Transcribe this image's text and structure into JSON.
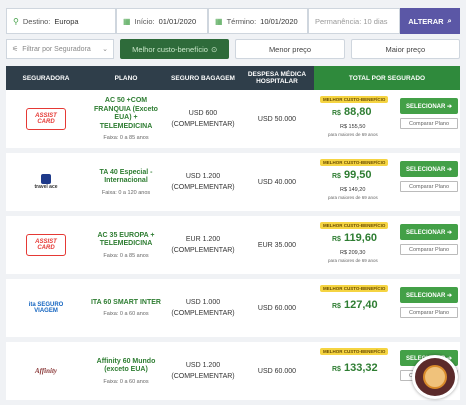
{
  "search": {
    "destino_label": "Destino:",
    "destino_value": "Europa",
    "inicio_label": "Início:",
    "inicio_value": "01/01/2020",
    "termino_label": "Término:",
    "termino_value": "10/01/2020",
    "permanencia": "Permanência: 10 dias",
    "alterar_label": "ALTERAR"
  },
  "filters": {
    "seguradora_placeholder": "Filtrar por Seguradora",
    "sort_options": [
      "Melhor custo-benefício",
      "Menor preço",
      "Maior preço"
    ],
    "active_sort": "Melhor custo-benefício"
  },
  "table": {
    "headers": [
      "SEGURADORA",
      "PLANO",
      "SEGURO BAGAGEM",
      "DESPESA MÉDICA HOSPITALAR",
      "TOTAL POR SEGURADO"
    ],
    "rows": [
      {
        "logo": "ASSIST CARD",
        "plan": "AC 50 +COM FRANQUIA (Exceto EUA) + TELEMEDICINA",
        "age": "Faixa: 0 a 85 anos",
        "bagagem_value": "USD 600",
        "bagagem_type": "(COMPLEMENTAR)",
        "medica": "USD 50.000",
        "badge": "MELHOR CUSTO-BENEFÍCIO",
        "price": "88,80",
        "old_price": "R$ 155,50",
        "note": "para maiores de 69 anos"
      },
      {
        "logo": "travel ace",
        "plan": "TA 40 Especial - Internacional",
        "age": "Faixa: 0 a 120 anos",
        "bagagem_value": "USD 1.200",
        "bagagem_type": "(COMPLEMENTAR)",
        "medica": "USD 40.000",
        "badge": "MELHOR CUSTO-BENEFÍCIO",
        "price": "99,50",
        "old_price": "R$ 149,20",
        "note": "para maiores de 69 anos"
      },
      {
        "logo": "ASSIST CARD",
        "plan": "AC 35 EUROPA + TELEMEDICINA",
        "age": "Faixa: 0 a 85 anos",
        "bagagem_value": "EUR 1.200",
        "bagagem_type": "(COMPLEMENTAR)",
        "medica": "EUR 35.000",
        "badge": "MELHOR CUSTO-BENEFÍCIO",
        "price": "119,60",
        "old_price": "R$ 209,30",
        "note": "para maiores de 69 anos"
      },
      {
        "logo": "ita SEGURO VIAGEM",
        "plan": "ITA 60 SMART INTER",
        "age": "Faixa: 0 a 60 anos",
        "bagagem_value": "USD 1.000",
        "bagagem_type": "(COMPLEMENTAR)",
        "medica": "USD 60.000",
        "badge": "MELHOR CUSTO-BENEFÍCIO",
        "price": "127,40",
        "old_price": "",
        "note": ""
      },
      {
        "logo": "Affinity",
        "plan": "Affinity 60 Mundo (exceto EUA)",
        "age": "Faixa: 0 a 60 anos",
        "bagagem_value": "USD 1.200",
        "bagagem_type": "(COMPLEMENTAR)",
        "medica": "USD 60.000",
        "badge": "MELHOR CUSTO-BENEFÍCIO",
        "price": "133,32",
        "old_price": "",
        "note": ""
      }
    ],
    "currency": "R$",
    "select_label": "SELECIONAR ➔",
    "compare_label": "Comparar Plano"
  },
  "colors": {
    "header_dark": "#2f3e4a",
    "total_green": "#2f8a3c",
    "accent_green": "#43a047",
    "alterar_purple": "#5b57a6",
    "badge_yellow": "#f5d442"
  }
}
